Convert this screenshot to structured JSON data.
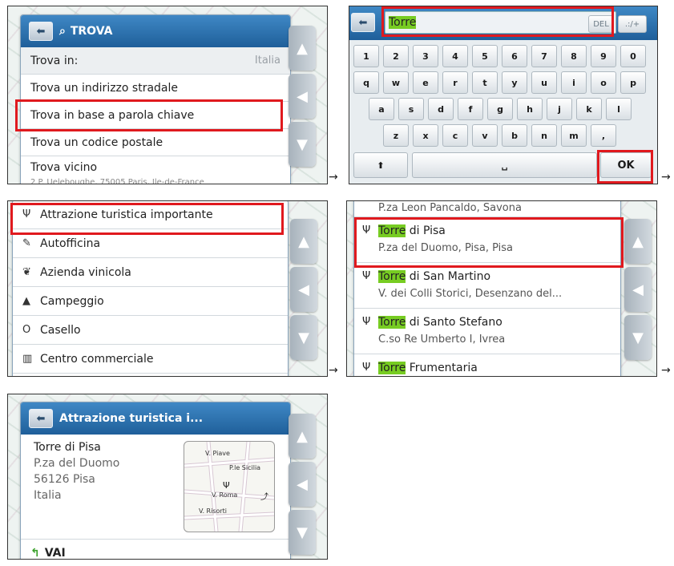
{
  "panel1": {
    "title": "TROVA",
    "rows": [
      {
        "label": "Trova in:",
        "value": "Italia"
      },
      {
        "label": "Trova un indirizzo stradale"
      },
      {
        "label": "Trova in base a parola chiave"
      },
      {
        "label": "Trova un codice postale"
      },
      {
        "label": "Trova vicino"
      }
    ],
    "partial_sub": "2 P. Ueleboughe, 75005 Paris, Ile-de-France"
  },
  "panel2": {
    "input_value": "Torre",
    "del_label": "DEL",
    "symbols_label": ".:/+",
    "row1": [
      "1",
      "2",
      "3",
      "4",
      "5",
      "6",
      "7",
      "8",
      "9",
      "0"
    ],
    "row2": [
      "q",
      "w",
      "e",
      "r",
      "t",
      "y",
      "u",
      "i",
      "o",
      "p"
    ],
    "row3": [
      "a",
      "s",
      "d",
      "f",
      "g",
      "h",
      "j",
      "k",
      "l"
    ],
    "row4": [
      "z",
      "x",
      "c",
      "v",
      "b",
      "n",
      "m",
      ","
    ],
    "shift_label": "⬆",
    "space_label": "␣",
    "ok_label": "OK"
  },
  "panel3": {
    "rows": [
      {
        "icon": "Ψ",
        "label": "Attrazione turistica importante"
      },
      {
        "icon": "✎",
        "label": "Autofficina"
      },
      {
        "icon": "❦",
        "label": "Azienda vinicola"
      },
      {
        "icon": "▲",
        "label": "Campeggio"
      },
      {
        "icon": "O",
        "label": "Casello"
      },
      {
        "icon": "▥",
        "label": "Centro commerciale"
      }
    ]
  },
  "panel4": {
    "top_partial": "P.za Leon Pancaldo, Savona",
    "match": "Torre",
    "results": [
      {
        "rest": " di Pisa",
        "sub": "P.za del Duomo, Pisa, Pisa"
      },
      {
        "rest": " di San Martino",
        "sub": "V. dei Colli Storici, Desenzano del..."
      },
      {
        "rest": " di Santo Stefano",
        "sub": "C.so Re Umberto I, Ivrea"
      },
      {
        "rest": " Frumentaria",
        "sub": ""
      }
    ]
  },
  "panel5": {
    "title": "Attrazione turistica i...",
    "name": "Torre di Pisa",
    "address1": "P.za del Duomo",
    "address2": "56126 Pisa",
    "country": "Italia",
    "map_labels": {
      "a": "V. Piave",
      "b": "P.le Sicilia",
      "c": "V. Roma",
      "d": "V. Risorti"
    },
    "go_label": "VAI"
  },
  "arrow_glyph": "→",
  "colors": {
    "highlight": "#e0191e",
    "title_blue": "#2f74b5",
    "match_green": "#77cc22"
  }
}
